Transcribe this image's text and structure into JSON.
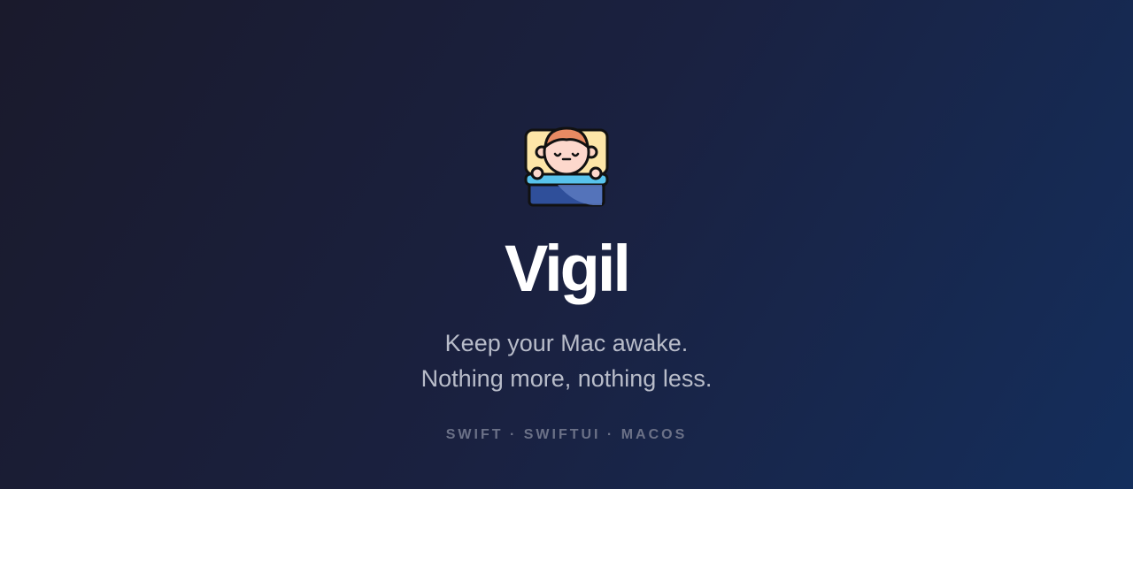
{
  "hero": {
    "logo_icon": "sleeping-character-in-bed-icon",
    "title": "Vigil",
    "tagline_line1": "Keep your Mac awake.",
    "tagline_line2": "Nothing more, nothing less.",
    "tech_stack": "SWIFT · SWIFTUI · MACOS"
  },
  "colors": {
    "background_start": "#1a1a2c",
    "background_end": "#142e5c",
    "title": "#ffffff",
    "tagline": "#b8bcc9",
    "tech_stack": "#6b7187"
  }
}
